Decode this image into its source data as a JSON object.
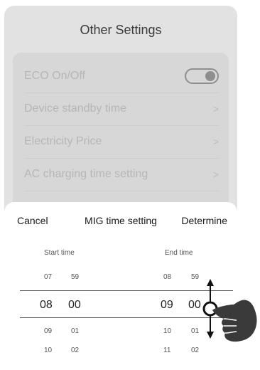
{
  "background": {
    "title": "Other Settings",
    "items": [
      {
        "label": "ECO On/Off",
        "control": "toggle",
        "toggle_on": true
      },
      {
        "label": "Device standby time",
        "control": "chevron",
        "chevron": ">"
      },
      {
        "label": "Electricity Price",
        "control": "chevron",
        "chevron": ">"
      },
      {
        "label": "AC charging time setting",
        "control": "chevron",
        "chevron": ">"
      }
    ]
  },
  "sheet": {
    "cancel_label": "Cancel",
    "title": "MIG time setting",
    "determine_label": "Determine",
    "start": {
      "label": "Start time",
      "hours": [
        "07",
        "08",
        "09",
        "10"
      ],
      "minutes": [
        "59",
        "00",
        "01",
        "02"
      ],
      "selected_hour": "08",
      "selected_minute": "00"
    },
    "end": {
      "label": "End time",
      "hours": [
        "08",
        "09",
        "10",
        "11"
      ],
      "minutes": [
        "59",
        "00",
        "01",
        "02"
      ],
      "selected_hour": "09",
      "selected_minute": "00"
    }
  },
  "gesture": {
    "icon": "swipe-hand-icon",
    "arrows": "up-down-arrows-icon"
  }
}
